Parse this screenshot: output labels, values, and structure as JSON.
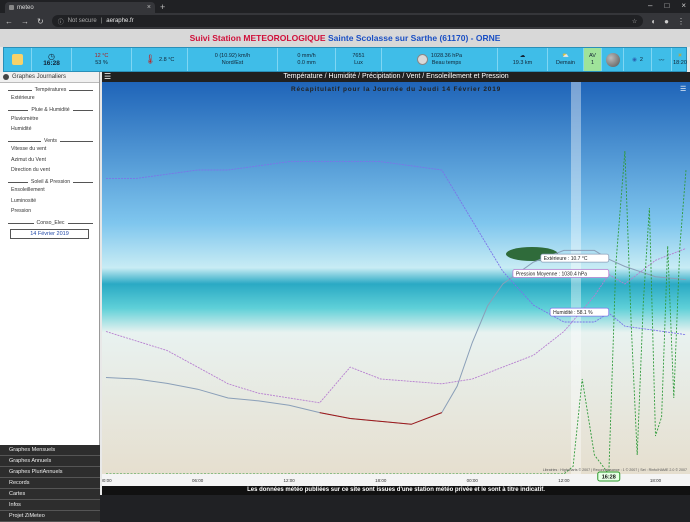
{
  "browser": {
    "tab_title": "meteo",
    "tab_close": "×",
    "new_tab": "+",
    "security": "Not secure",
    "url": "aeraphe.fr",
    "window_controls": [
      "–",
      "□",
      "×"
    ]
  },
  "station": {
    "title_a": "Suivi Station METEOROLOGIQUE",
    "title_b": "Sainte Scolasse sur Sarthe (61170) - ORNE"
  },
  "weather": {
    "time": "16:28",
    "hum_temp": "12 °C",
    "hum_pct": "53 %",
    "dewpoint": "2.8 °C",
    "wind": "0 (10.92) km/h",
    "wind_dir": "Nord/Est",
    "rain1": "0 mm/h",
    "rain2": "0.0 mm",
    "lux_value": "7651",
    "lux_unit": "Lux",
    "pressure": "1028.36 hPa",
    "forecast": "Beau temps",
    "cloud": "19.3 km",
    "tomorrow": "Demain",
    "uv": "AV",
    "uv_val": "1",
    "sunset": "18:20",
    "moon_count": "2"
  },
  "sidebar": {
    "header": "Graphes Journaliers",
    "sections": [
      {
        "title": "Températures",
        "links": [
          "Extérieure"
        ]
      },
      {
        "title": "Pluie & Humidité",
        "links": [
          "Pluviomètre",
          "Humidité"
        ]
      },
      {
        "title": "Vents",
        "links": [
          "Vitesse du vent",
          "Azimut du Vent",
          "Direction du vent"
        ]
      },
      {
        "title": "Soleil & Pression",
        "links": [
          "Ensoleillement",
          "Luminosité",
          "Pression"
        ]
      },
      {
        "title": "Conso_Elec",
        "links": []
      }
    ],
    "date": "14 Février 2019",
    "bottom": [
      "Graphes Mensuels",
      "Graphes Annuels",
      "Graphes PluriAnnuels",
      "Records",
      "Cartes",
      "Infos",
      "Projet ZiMeteo"
    ]
  },
  "main": {
    "title": "Température / Humidité / Précipitation / Vent / Ensoleillement et Pression",
    "subtitle": "Récapitulatif pour la Journée du Jeudi 14 Février 2019",
    "footer": "Les données météo publiées sur ce site sont issues d'une station météo privée et le sont à titre indicatif."
  },
  "chart_data": {
    "type": "line",
    "x_ticks": [
      "00:00",
      "06:00",
      "12:00",
      "18:00",
      "00:00",
      "12:00",
      "18:00"
    ],
    "x_hours_for_ticks": [
      0,
      3,
      6,
      9,
      12,
      15,
      18
    ],
    "cursor_label": "16:28",
    "series": [
      {
        "name": "Extérieure",
        "unit": "°C",
        "color": "#8a9fb8",
        "x": [
          0,
          1,
          2,
          3,
          4,
          5,
          6,
          7,
          8,
          9,
          10,
          11,
          11.5,
          12,
          12.5,
          13,
          14,
          15,
          16,
          16.47,
          17,
          18,
          19
        ],
        "y": [
          2.6,
          2.5,
          2.2,
          1.8,
          1.2,
          1.0,
          0.7,
          0.2,
          -0.2,
          -0.4,
          -0.6,
          0.2,
          2,
          5,
          7.5,
          9.0,
          10.5,
          11.3,
          11.3,
          10.7,
          10.2,
          9.5,
          9.3
        ]
      },
      {
        "name": "Pression Moyenne",
        "unit": "hPa",
        "color": "#b77fd0",
        "x": [
          0,
          1,
          2,
          3,
          4,
          5,
          6,
          7,
          8,
          9,
          10,
          11,
          12,
          13,
          14,
          15,
          16,
          16.47,
          17,
          18,
          19
        ],
        "y": [
          1028.0,
          1027.6,
          1027.2,
          1026.5,
          1025.8,
          1025.4,
          1025.2,
          1025.0,
          1026.5,
          1026.0,
          1025.9,
          1025.8,
          1026.0,
          1026.5,
          1027.0,
          1028.0,
          1029.5,
          1030.4,
          1030.0,
          1031.0,
          1031.5
        ]
      },
      {
        "name": "Humidité",
        "unit": "%",
        "color": "#7b74e8",
        "x": [
          0,
          1,
          2,
          3,
          4,
          5,
          6,
          7,
          8,
          9,
          10,
          11,
          12,
          13,
          14,
          15,
          16,
          16.47,
          17,
          18,
          19
        ],
        "y": [
          90,
          90,
          91,
          92,
          92,
          93,
          94,
          94,
          94,
          94,
          93,
          92,
          80,
          68,
          60,
          56,
          56,
          58.1,
          55,
          54,
          53
        ]
      },
      {
        "name": "Ensoleillement",
        "unit": "",
        "color": "#2f9a3a",
        "x": [
          0,
          12,
          15,
          15.3,
          15.6,
          16,
          16.47,
          16.7,
          17,
          17.2,
          17.4,
          17.6,
          17.8,
          18,
          18.2,
          18.4,
          18.6,
          18.8,
          19
        ],
        "y": [
          0,
          0,
          0,
          2,
          25,
          5,
          0,
          55,
          85,
          40,
          5,
          45,
          70,
          10,
          15,
          60,
          20,
          60,
          80
        ]
      }
    ],
    "tooltips": [
      "Extérieure : 10.7 °C",
      "Pression Moyenne : 1030.4 hPa",
      "Humidité : 58.1 %"
    ],
    "credit": "Librairies : Highcharts © 2007 | Reconnaissance : 1 © 2007 | Set : Rinfo/HAME 2.0 © 2007"
  }
}
